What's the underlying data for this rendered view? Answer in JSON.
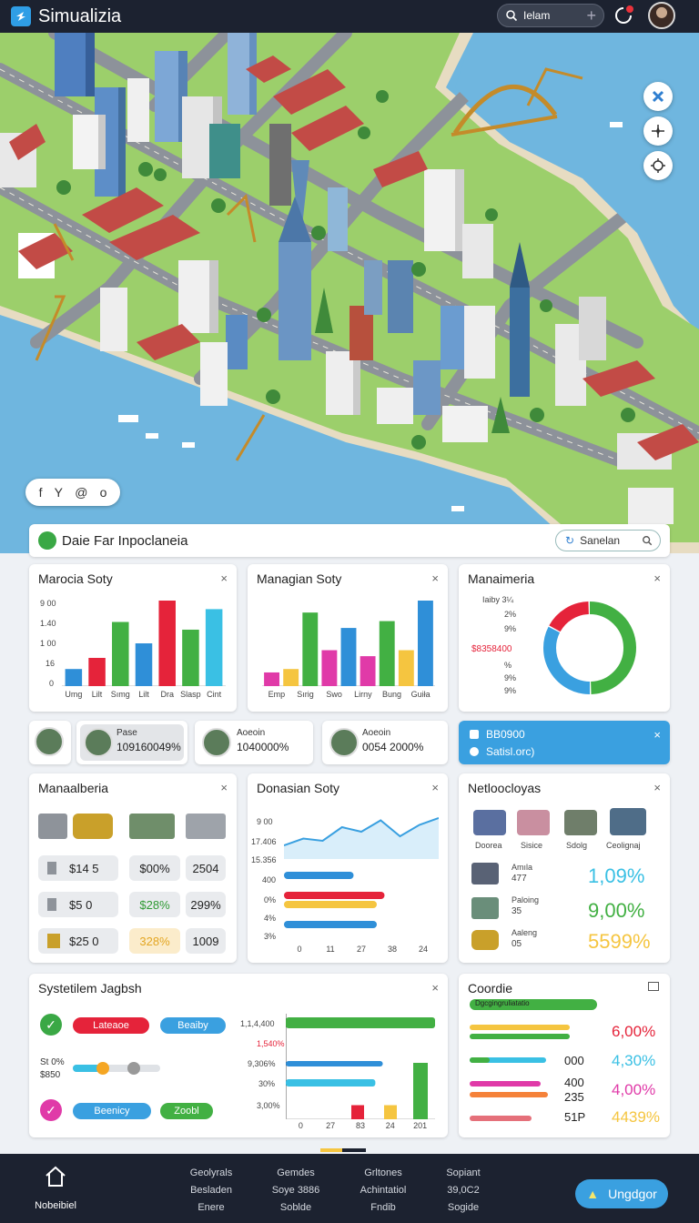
{
  "app": {
    "title": "Simualizia"
  },
  "topbar": {
    "search_text": "Ielam"
  },
  "map": {
    "social_icons": [
      "f",
      "Y",
      "@",
      "o"
    ]
  },
  "section": {
    "title": "Daie Far Inpoclaneia",
    "search_text": "Sanelan"
  },
  "cards": {
    "bar1": {
      "title": "Marocia Soty",
      "close": "×",
      "y_ticks": [
        "9 00",
        "1.40",
        "1 00",
        "16",
        "0"
      ],
      "chart_data": {
        "type": "bar",
        "categories": [
          "Umg",
          "Lilt",
          "Sımg",
          "Lilt",
          "Dra",
          "Slasp",
          "Cint"
        ],
        "values": [
          20,
          33,
          75,
          50,
          100,
          66,
          90
        ],
        "colors": [
          "#2f8fd8",
          "#e5233a",
          "#42b043",
          "#2f8fd8",
          "#e5233a",
          "#42b043",
          "#3ac0e4"
        ]
      }
    },
    "bar2": {
      "title": "Managian Soty",
      "close": "×",
      "chart_data": {
        "type": "bar",
        "categories": [
          "Emp",
          "Sırig",
          "Swo",
          "Lirny",
          "Bung",
          "Guiła"
        ],
        "values": [
          16,
          20,
          86,
          42,
          68,
          35,
          76,
          42,
          100
        ],
        "colors": [
          "#e03aa8",
          "#f5c540",
          "#42b043",
          "#e03aa8",
          "#2f8fd8",
          "#e03aa8",
          "#42b043",
          "#f5c540",
          "#2f8fd8"
        ]
      }
    },
    "donut": {
      "title": "Manaimeria",
      "close": "×",
      "labels": [
        "Iaiby 3¼",
        "2%",
        "9%",
        "$8358400",
        "%",
        "9%",
        "9%"
      ],
      "chart_data": {
        "type": "pie",
        "values": [
          50,
          33,
          17
        ],
        "colors": [
          "#42b043",
          "#3aa0e0",
          "#e5233a"
        ]
      }
    },
    "stats": [
      {
        "label": "Pase",
        "value": "109160049%"
      },
      {
        "label": "Aoeoin",
        "value": "1040000%"
      },
      {
        "label": "Aoeoin",
        "value": "0054 2000%"
      }
    ],
    "blue_stat": {
      "line1": "BB0900",
      "line2": "Satisl.orc)",
      "close": "×"
    },
    "mana": {
      "title": "Manaalberia",
      "close": "×",
      "rows": [
        [
          "$14 5",
          "$00%",
          "2504"
        ],
        [
          "$5 0",
          "$28%",
          "299%"
        ],
        [
          "$25 0",
          "328%",
          "1009"
        ]
      ]
    },
    "line": {
      "title": "Donasian Soty",
      "close": "×",
      "y_ticks": [
        "9 00",
        "17.406",
        "15.356",
        "400",
        "0%",
        "4%",
        "3%"
      ],
      "x_ticks": [
        "0",
        "11",
        "27",
        "38",
        "24"
      ],
      "chart_data": {
        "type": "line",
        "x": [
          0,
          1,
          2,
          3,
          4,
          5,
          6,
          7,
          8
        ],
        "y": [
          12,
          18,
          16,
          28,
          24,
          34,
          20,
          30,
          36
        ]
      },
      "bars": [
        {
          "value": 45,
          "color": "#2f8fd8"
        },
        {
          "value": 65,
          "color": "#e5233a"
        },
        {
          "value": 60,
          "color": "#f5c540"
        },
        {
          "value": 60,
          "color": "#2f8fd8"
        }
      ]
    },
    "neto": {
      "title": "Netloocloyas",
      "close": "×",
      "icon_labels": [
        "Doorea",
        "Sisice",
        "Sdolg",
        "Ceolignaj"
      ],
      "rows": [
        {
          "label": "Amıla",
          "sub": "477",
          "pct": "1,09%",
          "color": "#3ac0e4"
        },
        {
          "label": "Paloing",
          "sub": "35",
          "pct": "9,00%",
          "color": "#42b043"
        },
        {
          "label": "Aaleng",
          "sub": "05",
          "pct": "5599%",
          "color": "#f5c540"
        }
      ]
    },
    "sys": {
      "title": "Systetilem Jagbsh",
      "close": "×",
      "left_text": [
        "St 0%",
        "$850"
      ],
      "pills": [
        {
          "text": "Lateaoe",
          "color": "#e5233a"
        },
        {
          "text": "Beaiby",
          "color": "#3aa0e0"
        },
        {
          "text": "Beenicy",
          "color": "#3aa0e0"
        },
        {
          "text": "Zoobl",
          "color": "#42b043"
        }
      ],
      "y_ticks": [
        "1,1,4,400",
        "1,540%",
        "9,306%",
        "30%",
        "3,00%"
      ],
      "x_ticks": [
        "0",
        "27",
        "83",
        "24",
        "201"
      ],
      "bars": [
        {
          "value": 100,
          "color": "#42b043"
        },
        {
          "value": 65,
          "color": "#2f8fd8"
        },
        {
          "value": 60,
          "color": "#3ac0e4"
        }
      ],
      "cols": [
        {
          "value": 25,
          "color": "#e5233a"
        },
        {
          "value": 25,
          "color": "#f5c540"
        },
        {
          "value": 100,
          "color": "#42b043"
        }
      ]
    },
    "coords": {
      "title": "Coordie",
      "progress_label": "Dgcgingruliatatio",
      "rows": [
        {
          "left": "",
          "pct": "6,00%",
          "color": "#e5233a"
        },
        {
          "left": "000",
          "pct": "4,30%",
          "color": "#3ac0e4"
        },
        {
          "left": "400",
          "pct": "4,00%",
          "color": "#e03aa8"
        },
        {
          "left": "235",
          "pct": "",
          "color": ""
        },
        {
          "left": "51P",
          "pct": "4439%",
          "color": "#f5c540"
        }
      ]
    }
  },
  "bottom": {
    "home_label": "Nobeibiel",
    "cols": [
      [
        "Geolyrals",
        "Besladen",
        "Enere"
      ],
      [
        "Gemdes",
        "Soye 3886",
        "Soblde"
      ],
      [
        "Grltones",
        "Achintatiol",
        "Fndib"
      ],
      [
        "Sopiant",
        "39,0C2",
        "Sogide"
      ]
    ],
    "upgrade_label": "Ungdgor"
  },
  "colors": {
    "accent": "#3aa0e0",
    "green": "#42b043",
    "red": "#e5233a",
    "yellow": "#f5c540",
    "dark": "#1c2230"
  }
}
